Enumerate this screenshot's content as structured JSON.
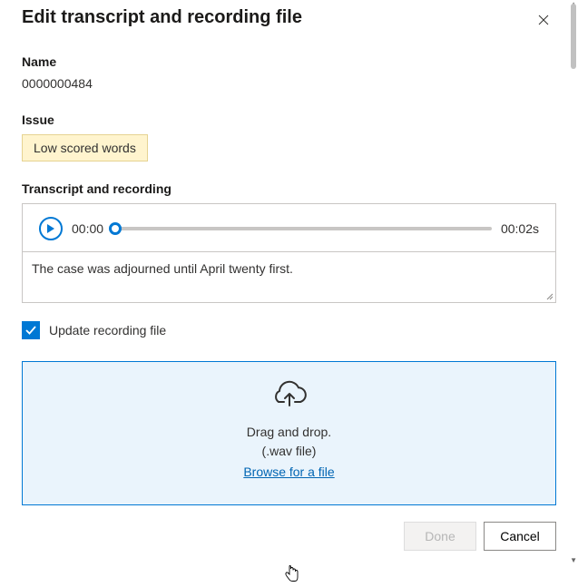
{
  "header": {
    "title": "Edit transcript and recording file",
    "close_icon": "close"
  },
  "name": {
    "label": "Name",
    "value": "0000000484"
  },
  "issue": {
    "label": "Issue",
    "tag": "Low scored words"
  },
  "transcript": {
    "label": "Transcript and recording",
    "currentTime": "00:00",
    "duration": "00:02s",
    "text": "The case was adjourned until April twenty first."
  },
  "updateCheckbox": {
    "label": "Update recording file",
    "checked": true
  },
  "dropzone": {
    "line1": "Drag and drop.",
    "line2": "(.wav file)",
    "browse": "Browse for a file"
  },
  "footer": {
    "done": "Done",
    "cancel": "Cancel"
  }
}
